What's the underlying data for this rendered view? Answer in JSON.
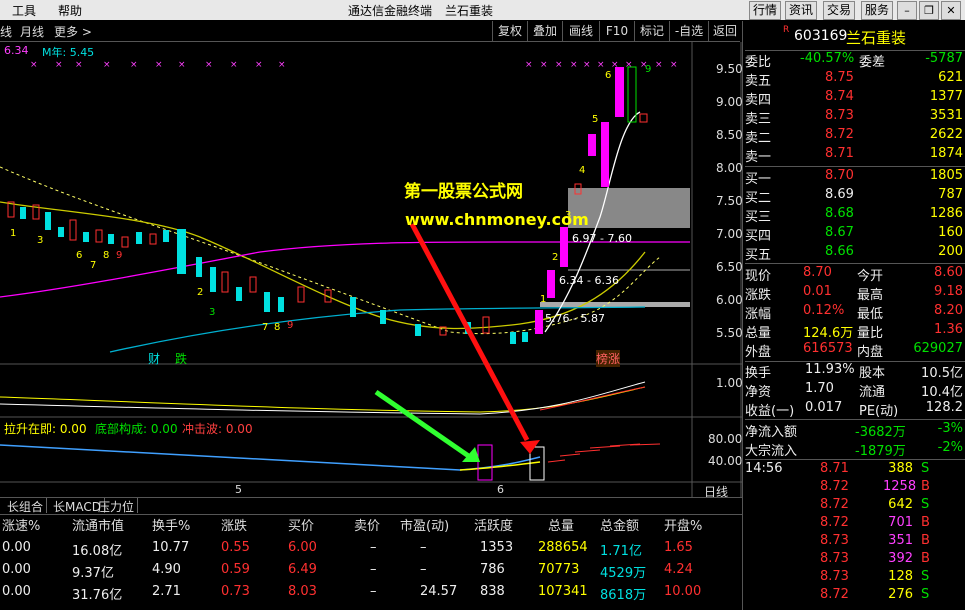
{
  "menu": {
    "tools": "工具",
    "help": "帮助",
    "title": "通达信金融终端",
    "stock_name_title": "兰石重装"
  },
  "top_right_buttons": [
    "行情",
    "资讯",
    "交易",
    "服务"
  ],
  "toolbar": {
    "left": [
      "线",
      "月线",
      "更多 >"
    ],
    "buttons": [
      "复权",
      "叠加",
      "画线",
      "F10",
      "标记",
      "-自选",
      "返回"
    ]
  },
  "chart": {
    "ma_label1": "6.34",
    "ma_label2": "M年: 5.45",
    "watermark_title": "第一股票公式网",
    "watermark_url": "www.chnmoney.com",
    "price_axis": [
      "9.50",
      "9.00",
      "8.50",
      "8.00",
      "7.50",
      "7.00",
      "6.50",
      "6.00",
      "5.50"
    ],
    "range_labels": [
      "6.97 - 7.60",
      "6.34 - 6.36",
      "5.76 - 5.87"
    ],
    "count_labels": [
      "1",
      "3",
      "6",
      "7",
      "8",
      "9",
      "2",
      "3",
      "7",
      "8",
      "9",
      "1",
      "2",
      "3",
      "4",
      "5",
      "6",
      "9",
      "4",
      "5"
    ],
    "event_labels": [
      "财",
      "跌",
      "榜涨"
    ],
    "sub_axis1": "1.00",
    "indicator_labels": {
      "a": "拉升在即: 0.00",
      "b": "底部构成: 0.00",
      "c": "冲击波: 0.00"
    },
    "sub_axis2": [
      "80.00",
      "40.00"
    ],
    "x_axis": [
      "5",
      "6"
    ],
    "day_label": "日线"
  },
  "colors": {
    "up": "#ff3030",
    "down": "#00e0e0",
    "magenta": "#ff00ff",
    "yellow": "#ffff00"
  },
  "bottom_tabs": [
    "长组合",
    "长MACD",
    "压力位"
  ],
  "table": {
    "headers": [
      "涨速%",
      "流通市值",
      "换手%",
      "涨跌",
      "买价",
      "卖价",
      "市盈(动)",
      "活跃度",
      "总量",
      "总金额",
      "开盘%"
    ],
    "rows": [
      [
        "0.00",
        "16.08亿",
        "10.77",
        "0.55",
        "6.00",
        "–",
        "–",
        "1353",
        "288654",
        "1.71亿",
        "1.65"
      ],
      [
        "0.00",
        "9.37亿",
        "4.90",
        "0.59",
        "6.49",
        "–",
        "–",
        "786",
        "70773",
        "4529万",
        "4.24"
      ],
      [
        "0.00",
        "31.76亿",
        "2.71",
        "0.73",
        "8.03",
        "–",
        "24.57",
        "838",
        "107341",
        "8618万",
        "10.00"
      ]
    ]
  },
  "quote": {
    "code": "603169",
    "name": "兰石重装",
    "badge": "R",
    "weibi_label": "委比",
    "weibi": "-40.57%",
    "weicha_label": "委差",
    "weicha": "-5787",
    "asks": [
      [
        "卖五",
        "8.75",
        "621"
      ],
      [
        "卖四",
        "8.74",
        "1377"
      ],
      [
        "卖三",
        "8.73",
        "3531"
      ],
      [
        "卖二",
        "8.72",
        "2622"
      ],
      [
        "卖一",
        "8.71",
        "1874"
      ]
    ],
    "bids": [
      [
        "买一",
        "8.70",
        "1805"
      ],
      [
        "买二",
        "8.69",
        "787"
      ],
      [
        "买三",
        "8.68",
        "1286"
      ],
      [
        "买四",
        "8.67",
        "160"
      ],
      [
        "买五",
        "8.66",
        "200"
      ]
    ],
    "stats": [
      [
        "现价",
        "8.70",
        "今开",
        "8.60"
      ],
      [
        "涨跌",
        "0.01",
        "最高",
        "9.18"
      ],
      [
        "涨幅",
        "0.12%",
        "最低",
        "8.20"
      ],
      [
        "总量",
        "124.6万",
        "量比",
        "1.36"
      ],
      [
        "外盘",
        "616573",
        "内盘",
        "629027"
      ]
    ],
    "stats2": [
      [
        "换手",
        "11.93%",
        "股本",
        "10.5亿"
      ],
      [
        "净资",
        "1.70",
        "流通",
        "10.4亿"
      ],
      [
        "收益(一)",
        "0.017",
        "PE(动)",
        "128.2"
      ]
    ],
    "flows": [
      [
        "净流入额",
        "-3682万",
        "-3%"
      ],
      [
        "大宗流入",
        "-1879万",
        "-2%"
      ]
    ],
    "ticks": [
      [
        "14:56",
        "8.71",
        "388",
        "S"
      ],
      [
        "",
        "8.72",
        "1258",
        "B"
      ],
      [
        "",
        "8.72",
        "642",
        "S"
      ],
      [
        "",
        "8.72",
        "701",
        "B"
      ],
      [
        "",
        "8.73",
        "351",
        "B"
      ],
      [
        "",
        "8.73",
        "392",
        "B"
      ],
      [
        "",
        "8.73",
        "128",
        "S"
      ],
      [
        "",
        "8.72",
        "276",
        "S"
      ]
    ]
  }
}
